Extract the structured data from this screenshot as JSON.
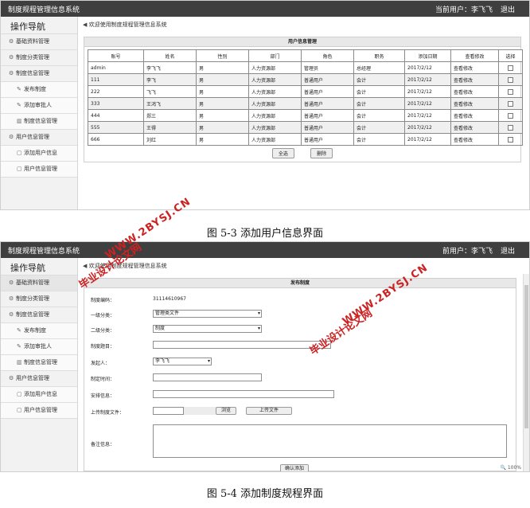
{
  "screen1": {
    "system_title": "制度规程管理信息系统",
    "current_user": "当前用户：李飞飞",
    "logout": "退出",
    "sidebar_title": "操作导航",
    "breadcrumb": "欢迎使用制度规程管理信息系统",
    "sidebar": [
      {
        "label": "基础资料管理",
        "icon": "gear-icon",
        "level": 1
      },
      {
        "label": "制度分类管理",
        "icon": "gear-icon",
        "level": 1
      },
      {
        "label": "制度信息管理",
        "icon": "gear-icon",
        "level": 1
      },
      {
        "label": "发布制度",
        "icon": "wrench-icon",
        "level": 2
      },
      {
        "label": "添加审批人",
        "icon": "wrench-icon",
        "level": 2
      },
      {
        "label": "制度信息管理",
        "icon": "trash-icon",
        "level": 2
      },
      {
        "label": "用户信息管理",
        "icon": "gear-icon",
        "level": 1
      },
      {
        "label": "添加用户信息",
        "icon": "document-icon",
        "level": 2
      },
      {
        "label": "用户信息管理",
        "icon": "document-icon",
        "level": 2
      }
    ],
    "panel_title": "用户信息管理",
    "columns": [
      "账号",
      "姓名",
      "性别",
      "部门",
      "角色",
      "职务",
      "添加日期",
      "查看修改",
      "选择"
    ],
    "rows": [
      [
        "admin",
        "李飞飞",
        "男",
        "人力资源部",
        "管理员",
        "总经理",
        "2017/2/12",
        "查看修改"
      ],
      [
        "111",
        "李飞",
        "男",
        "人力资源部",
        "普通用户",
        "会计",
        "2017/2/12",
        "查看修改"
      ],
      [
        "222",
        "飞飞",
        "男",
        "人力资源部",
        "普通用户",
        "会计",
        "2017/2/12",
        "查看修改"
      ],
      [
        "333",
        "王鸿飞",
        "男",
        "人力资源部",
        "普通用户",
        "会计",
        "2017/2/12",
        "查看修改"
      ],
      [
        "444",
        "郑三",
        "男",
        "人力资源部",
        "普通用户",
        "会计",
        "2017/2/12",
        "查看修改"
      ],
      [
        "555",
        "王得",
        "男",
        "人力资源部",
        "普通用户",
        "会计",
        "2017/2/12",
        "查看修改"
      ],
      [
        "666",
        "刘红",
        "男",
        "人力资源部",
        "普通用户",
        "会计",
        "2017/2/12",
        "查看修改"
      ]
    ],
    "select_all": "全选",
    "delete": "删除"
  },
  "caption1": "图 5-3 添加用户信息界面",
  "screen2": {
    "system_title": "制度规程管理信息系统",
    "current_user": "前用户：李飞飞",
    "logout": "退出",
    "sidebar_title": "操作导航",
    "breadcrumb": "欢迎使用制度规程管理信息系统",
    "form_title": "发布制度",
    "fields": {
      "code_label": "制度编码：",
      "code_value": "31114610967",
      "cat1_label": "一级分类：",
      "cat1_value": "管理类文件",
      "cat2_label": "二级分类：",
      "cat2_value": "制度",
      "title_label": "制度题目：",
      "initiator_label": "发起人：",
      "initiator_value": "李飞飞",
      "time_label": "制定时间：",
      "arrange_label": "安排信息：",
      "upload_label": "上传制度文件：",
      "browse_button": "浏览",
      "upload_button": "上传文件",
      "remark_label": "备注信息：",
      "confirm_button": "确认添加"
    },
    "zoom": "100%"
  },
  "caption2": "图 5-4 添加制度规程界面",
  "watermarks": [
    {
      "text": "毕业设计论文网"
    },
    {
      "text": "WWW.2BYSJ.CN"
    },
    {
      "text": "毕业设计论文网"
    },
    {
      "text": "WWW.2BYSJ.CN"
    }
  ],
  "colors": {
    "topbar": "#3f3f3f",
    "watermark": "#cc2222"
  }
}
